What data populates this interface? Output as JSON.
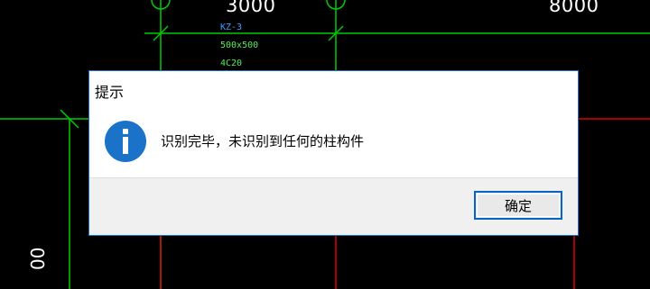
{
  "drawing": {
    "dimension_left": "3000",
    "dimension_right": "8000",
    "dimension_vertical": "00",
    "column_label": {
      "name": "KZ-3",
      "size": "500x500",
      "rebar": "4C20"
    }
  },
  "dialog": {
    "title": "提示",
    "icon": "info-icon",
    "message": "识别完毕，未识别到任何的柱构件",
    "ok_button_label": "确定"
  },
  "colors": {
    "background": "#000000",
    "grid_green": "#00cc00",
    "grid_red": "#e00000",
    "column_name_blue": "#3aa0ff",
    "dialog_accent": "#0a64c8",
    "info_icon_blue": "#1a73c9"
  }
}
